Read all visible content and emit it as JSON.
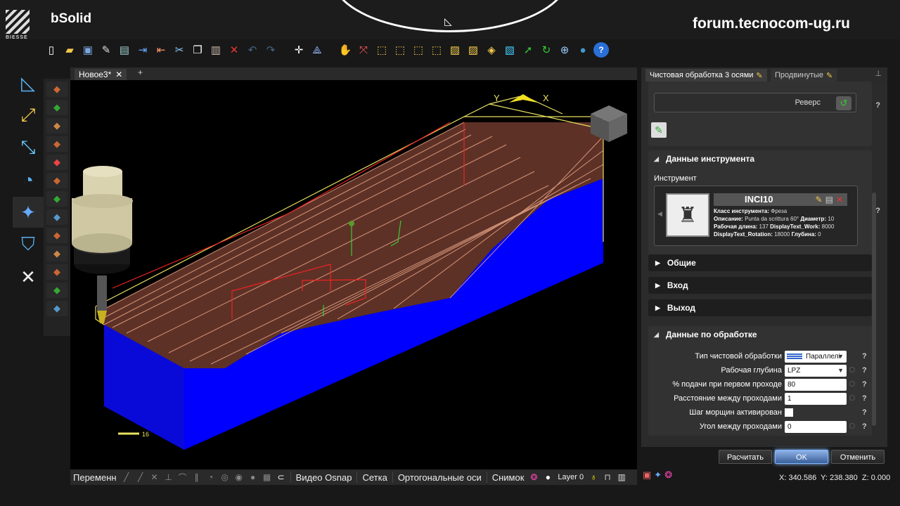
{
  "app": {
    "brand": "BIESSE",
    "title": "bSolid"
  },
  "watermark": "forum.tecnocom-ug.ru",
  "toolbar": {
    "icons": [
      "new-file-icon",
      "open-folder-icon",
      "save-icon",
      "edit-document-icon",
      "print-icon",
      "import-icon",
      "export-icon",
      "cut-icon",
      "copy-icon",
      "paste-icon",
      "delete-icon",
      "undo-icon",
      "redo-icon",
      "snap-point-icon",
      "axis-icon",
      "pan-hand-icon",
      "zoom-window-icon",
      "view-front-icon",
      "view-back-icon",
      "view-left-icon",
      "view-right-icon",
      "view-top-icon",
      "view-bottom-icon",
      "view-iso-icon",
      "view-3d-icon",
      "select-arrow-icon",
      "rotate-icon",
      "globe-icon",
      "sphere-icon",
      "help-icon"
    ]
  },
  "left_tools": [
    "drawing-icon",
    "transform-icon",
    "measure-icon",
    "dial-icon",
    "machining-icon",
    "shield-icon",
    "tools-icon"
  ],
  "document": {
    "tab": "Новое3*",
    "add": "+"
  },
  "viewport": {
    "axis_x": "X",
    "axis_y": "Y",
    "scale_marker": "16",
    "colors": {
      "part": "#0000ff",
      "toolpath": "#e0a080",
      "bounding": "#e8e060",
      "tool_holder": "#d9d3b0"
    }
  },
  "statusbar": {
    "variables": "Переменн",
    "video_osnap": "Видео Osnap",
    "grid": "Сетка",
    "ortho": "Ортогональные оси",
    "snapshot": "Снимок",
    "layer": "Layer 0"
  },
  "right_panel": {
    "tabs": [
      {
        "label": "Чистовая обработка 3 осями",
        "active": true
      },
      {
        "label": "Продвинутые",
        "active": false
      }
    ],
    "reverse_label": "Реверс",
    "tool_section": {
      "title": "Данные инструмента",
      "instrument_label": "Инструмент",
      "tool_name": "INCI10",
      "desc_lines": [
        {
          "k": "Класс инструмента:",
          "v": " Фреза"
        },
        {
          "k": "Описание:",
          "v": " Punta da scrittura 60°  ",
          "k2": "Диаметр:",
          "v2": " 10"
        },
        {
          "k": "Рабочая длина:",
          "v": " 137  ",
          "k2": "DisplayText_Work:",
          "v2": " 8000"
        },
        {
          "k": "DisplayText_Rotation:",
          "v": " 18000  ",
          "k2": "Глубина:",
          "v2": " 0"
        }
      ]
    },
    "collapsed": [
      "Общие",
      "Вход",
      "Выход"
    ],
    "machining": {
      "title": "Данные по обработке",
      "rows": [
        {
          "label": "Тип чистовой обработки",
          "value": "Параллелі",
          "type": "dropdown"
        },
        {
          "label": "Рабочая глубина",
          "value": "LPZ",
          "type": "dropdown"
        },
        {
          "label": "% подачи при первом проходе",
          "value": "80",
          "type": "input"
        },
        {
          "label": "Расстояние между проходами",
          "value": "1",
          "type": "input"
        },
        {
          "label": "Шаг морщин активирован",
          "value": "",
          "type": "checkbox"
        },
        {
          "label": "Угол между проходами",
          "value": "0",
          "type": "input"
        }
      ]
    },
    "help": "?",
    "buttons": {
      "calc": "Расчитать",
      "ok": "OK",
      "cancel": "Отменить"
    }
  },
  "coords": {
    "x": "X: 340.586",
    "y": "Y: 238.380",
    "z": "Z: 0.000"
  }
}
